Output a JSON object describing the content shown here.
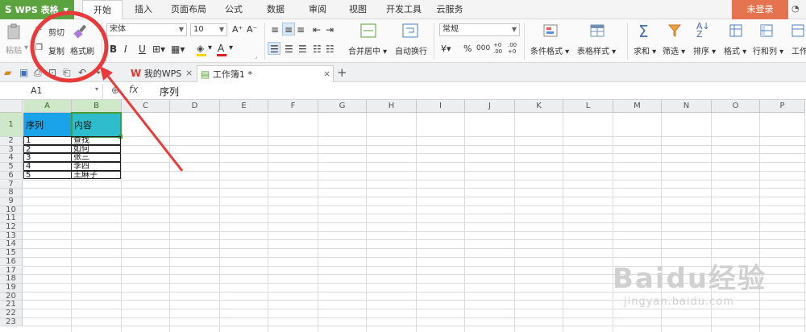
{
  "app": {
    "name": "WPS 表格",
    "logo": "S"
  },
  "menu": {
    "tabs": [
      {
        "label": "开始",
        "active": true
      },
      {
        "label": "插入"
      },
      {
        "label": "页面布局"
      },
      {
        "label": "公式"
      },
      {
        "label": "数据"
      },
      {
        "label": "审阅"
      },
      {
        "label": "视图"
      },
      {
        "label": "开发工具"
      },
      {
        "label": "云服务"
      }
    ],
    "login_label": "未登录"
  },
  "ribbon": {
    "paste_label": "粘贴",
    "cut_label": "剪切",
    "copy_label": "复制",
    "format_painter_label": "格式刷",
    "font_name": "宋体",
    "font_size": "10",
    "bold_label": "B",
    "italic_label": "I",
    "underline_label": "U",
    "merge_label": "合并居中",
    "wrap_label": "自动换行",
    "number_format": "常规",
    "percent_label": "%",
    "comma_label": "000",
    "conditional_format_label": "条件格式",
    "table_style_label": "表格样式",
    "sum_label": "求和",
    "filter_label": "筛选",
    "sort_label": "排序",
    "format_label": "格式",
    "rowcol_label": "行和列",
    "worksheet_label": "工作",
    "accent_color": "#5aa33e",
    "login_color": "#e5734f"
  },
  "doc_tabs": [
    {
      "label": "我的WPS"
    },
    {
      "label": "工作簿1 *",
      "active": true
    }
  ],
  "formula_bar": {
    "cell_ref": "A1",
    "fx_label": "fx",
    "value": "序列"
  },
  "sheet": {
    "columns": [
      "A",
      "B",
      "C",
      "D",
      "E",
      "F",
      "G",
      "H",
      "I",
      "J",
      "K",
      "L",
      "M",
      "N",
      "O",
      "P"
    ],
    "rows": [
      "1",
      "2",
      "3",
      "4",
      "5",
      "6",
      "7",
      "8",
      "9",
      "10",
      "11",
      "12",
      "13",
      "14",
      "15",
      "16",
      "17",
      "18",
      "19",
      "20",
      "21",
      "22",
      "23"
    ],
    "header_cells": {
      "a1": "序列",
      "b1": "内容"
    },
    "data_rows": [
      {
        "a": "1",
        "b": "查找"
      },
      {
        "a": "2",
        "b": "如何"
      },
      {
        "a": "3",
        "b": "张三"
      },
      {
        "a": "4",
        "b": "李四"
      },
      {
        "a": "5",
        "b": "王麻子"
      }
    ],
    "header_fill_a": "#1aa3e8",
    "header_fill_b": "#2fbccc"
  },
  "watermark": {
    "big": "Baidu经验",
    "small": "jingyan.baidu.com"
  }
}
